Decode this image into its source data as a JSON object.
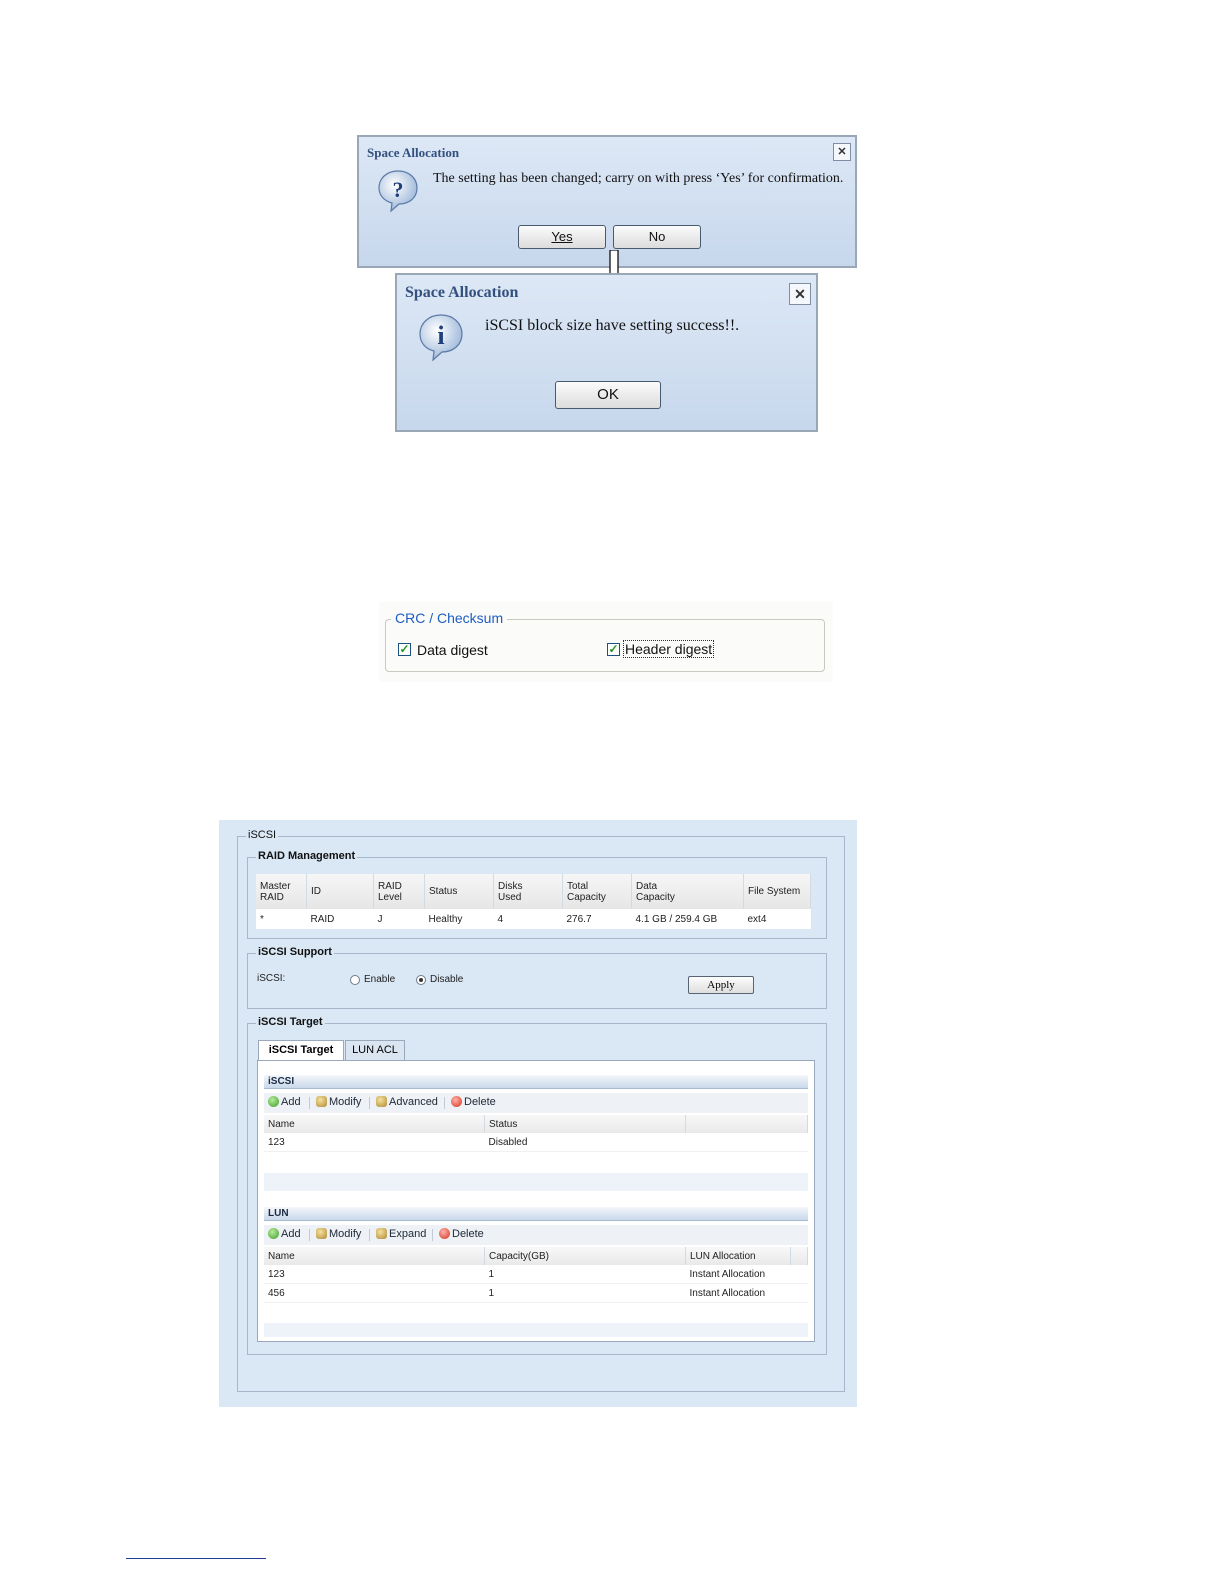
{
  "dialog_confirm": {
    "title": "Space Allocation",
    "message": "The setting has been changed; carry on with press ‘Yes’ for confirmation.",
    "yes_label": "Yes",
    "no_label": "No",
    "close_glyph": "✕",
    "icon": "question-icon",
    "icon_glyph": "?"
  },
  "dialog_info": {
    "title": "Space Allocation",
    "message": "iSCSI block size have setting success!!.",
    "ok_label": "OK",
    "close_glyph": "✕",
    "icon": "info-icon",
    "icon_glyph": "i"
  },
  "crc": {
    "legend": "CRC / Checksum",
    "data_digest_label": "Data digest",
    "header_digest_label": "Header digest",
    "data_digest_checked": true,
    "header_digest_checked": true,
    "check_glyph": "✓"
  },
  "iscsi_panel": {
    "title": "iSCSI",
    "raid": {
      "legend": "RAID Management",
      "columns": [
        "Master RAID",
        "ID",
        "RAID Level",
        "Status",
        "Disks Used",
        "Total Capacity",
        "Data Capacity",
        "File System"
      ],
      "col_lines": [
        [
          "Master",
          "RAID"
        ],
        [
          "ID",
          ""
        ],
        [
          "RAID",
          "Level"
        ],
        [
          "Status",
          ""
        ],
        [
          "Disks",
          "Used"
        ],
        [
          "Total",
          "Capacity"
        ],
        [
          "Data",
          "Capacity"
        ],
        [
          "File System",
          ""
        ]
      ],
      "rows": [
        [
          "*",
          "RAID",
          "J",
          "Healthy",
          "4",
          "276.7",
          "4.1 GB / 259.4 GB",
          "ext4"
        ]
      ]
    },
    "support": {
      "legend": "iSCSI Support",
      "label": "iSCSI:",
      "enable_label": "Enable",
      "disable_label": "Disable",
      "selected": "Disable",
      "apply_label": "Apply"
    },
    "target": {
      "legend": "iSCSI Target",
      "tabs": [
        "iSCSI Target",
        "LUN ACL"
      ],
      "active_tab": "iSCSI Target",
      "iscsi_section": {
        "title": "iSCSI",
        "toolbar": [
          "Add",
          "Modify",
          "Advanced",
          "Delete"
        ],
        "columns": [
          "Name",
          "Status"
        ],
        "rows": [
          [
            "123",
            "Disabled"
          ]
        ]
      },
      "lun_section": {
        "title": "LUN",
        "toolbar": [
          "Add",
          "Modify",
          "Expand",
          "Delete"
        ],
        "columns": [
          "Name",
          "Capacity(GB)",
          "LUN Allocation"
        ],
        "rows": [
          [
            "123",
            "1",
            "Instant Allocation"
          ],
          [
            "456",
            "1",
            "Instant Allocation"
          ]
        ]
      }
    }
  },
  "colors": {
    "dialog_title": "#33507e",
    "panel_bg": "#dae7f5",
    "crc_legend": "#1d5dc2",
    "link_underline": "#1f3f8f"
  }
}
